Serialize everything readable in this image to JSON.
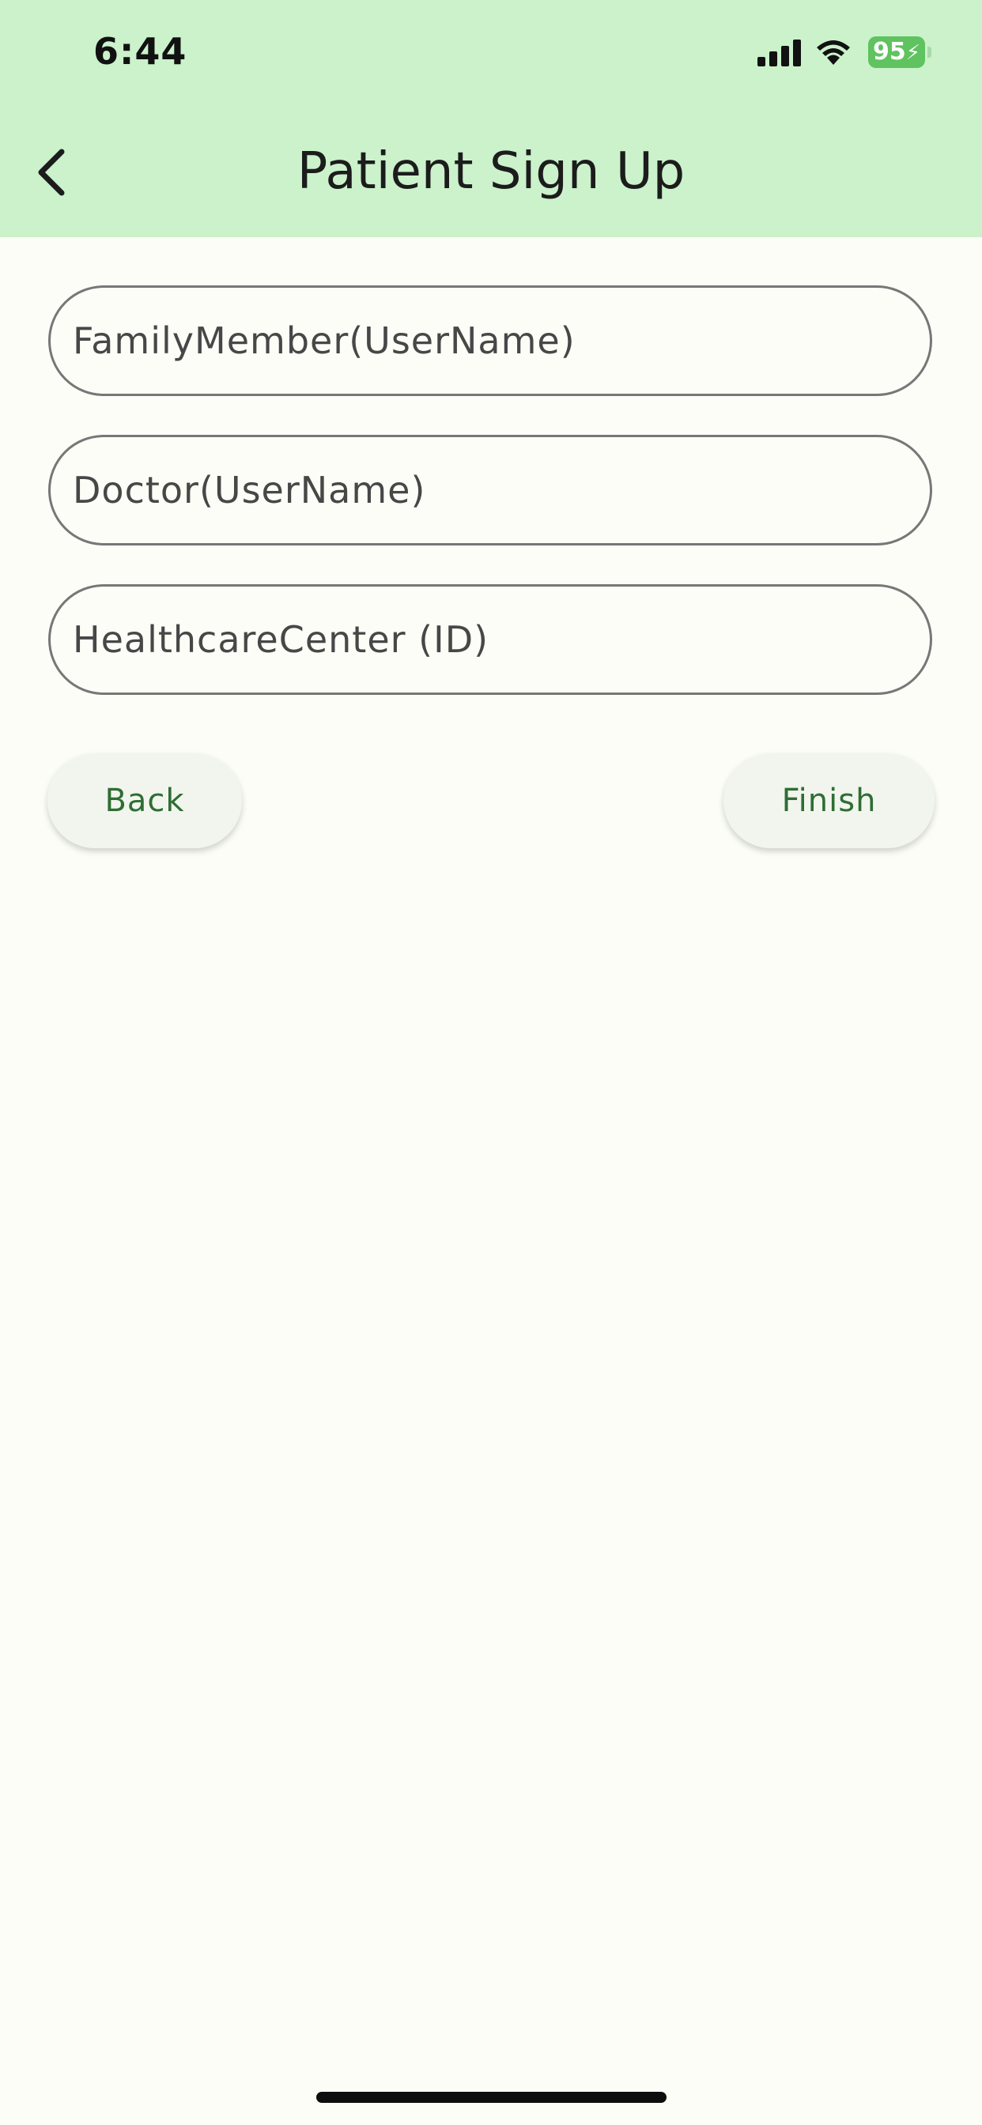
{
  "status_bar": {
    "time": "6:44",
    "battery_level": "95",
    "signal_icon": "cellular-signal-icon",
    "wifi_icon": "wifi-icon",
    "battery_color": "#5fc35f"
  },
  "app_bar": {
    "title": "Patient Sign Up",
    "back_icon": "chevron-left-icon",
    "background": "#cbf2cb"
  },
  "form": {
    "family_member": {
      "placeholder": "FamilyMember(UserName)",
      "value": ""
    },
    "doctor": {
      "placeholder": "Doctor(UserName)",
      "value": ""
    },
    "healthcare_center": {
      "placeholder": "HealthcareCenter (ID)",
      "value": ""
    }
  },
  "actions": {
    "back_label": "Back",
    "finish_label": "Finish",
    "accent": "#2e6e33"
  }
}
